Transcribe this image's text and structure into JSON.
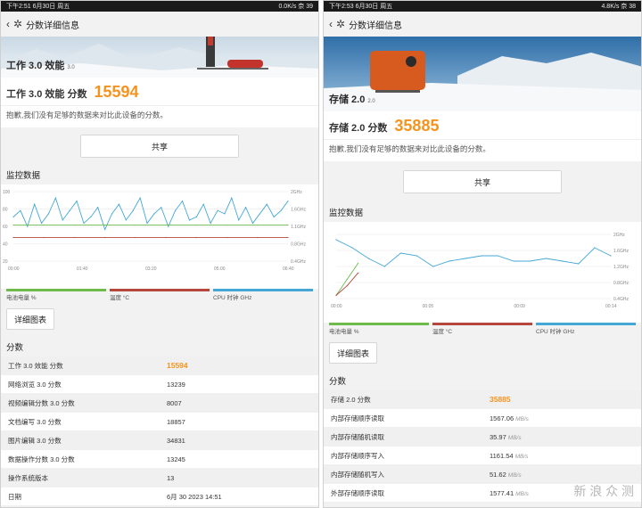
{
  "left": {
    "status": {
      "time": "下午2:51",
      "date": "6月30日 周五",
      "right": "0.0K/s 奈 39"
    },
    "title": "分数详细信息",
    "hero": {
      "name": "工作 3.0 效能",
      "version": "3.0"
    },
    "score_label": "工作 3.0 效能 分数",
    "score": "15594",
    "note": "抱歉,我们没有足够的数据来对比此设备的分数。",
    "share": "共享",
    "monitor_title": "监控数据",
    "legend": [
      {
        "label": "电池电量 %",
        "color": "#6dbb4b"
      },
      {
        "label": "温度 °C",
        "color": "#b5473e"
      },
      {
        "label": "CPU 时钟 GHz",
        "color": "#45a7d6"
      }
    ],
    "y_left_ticks": [
      "100",
      "80",
      "60",
      "40",
      "20"
    ],
    "y_right_ticks": [
      "2GHz",
      "1.6GHz",
      "1.1GHz",
      "0.8GHz",
      "0.4GHz"
    ],
    "x_ticks": [
      "00:00",
      "01:40",
      "03:20",
      "05:00",
      "06:40"
    ],
    "detail_btn": "详细图表",
    "scores_title": "分数",
    "rows": [
      {
        "k": "工作 3.0 效能 分数",
        "v": "15594",
        "hl": true
      },
      {
        "k": "网络浏览 3.0 分数",
        "v": "13239"
      },
      {
        "k": "视频编辑分数 3.0 分数",
        "v": "8007"
      },
      {
        "k": "文档编写 3.0 分数",
        "v": "18857"
      },
      {
        "k": "图片编辑 3.0 分数",
        "v": "34831"
      },
      {
        "k": "数据操作分数 3.0 分数",
        "v": "13245"
      },
      {
        "k": "操作系统版本",
        "v": "13"
      },
      {
        "k": "日期",
        "v": "6月 30 2023 14:51"
      }
    ]
  },
  "right": {
    "status": {
      "time": "下午2:53",
      "date": "6月30日 周五",
      "right": "4.8K/s 奈 38"
    },
    "title": "分数详细信息",
    "hero": {
      "name": "存储 2.0",
      "version": "2.0"
    },
    "score_label": "存储 2.0 分数",
    "score": "35885",
    "note": "抱歉,我们没有足够的数据来对比此设备的分数。",
    "share": "共享",
    "monitor_title": "监控数据",
    "legend": [
      {
        "label": "电池电量 %",
        "color": "#6dbb4b"
      },
      {
        "label": "温度 °C",
        "color": "#b5473e"
      },
      {
        "label": "CPU 时钟 GHz",
        "color": "#45a7d6"
      }
    ],
    "y_right_ticks": [
      "2GHz",
      "1.6GHz",
      "1.2GHz",
      "0.8GHz",
      "0.4GHz"
    ],
    "x_ticks": [
      "00:00",
      "00:05",
      "00:09",
      "00:14"
    ],
    "detail_btn": "详细图表",
    "scores_title": "分数",
    "rows": [
      {
        "k": "存储 2.0 分数",
        "v": "35885",
        "hl": true
      },
      {
        "k": "内部存储顺序读取",
        "v": "1567.06",
        "unit": "MB/s"
      },
      {
        "k": "内部存储随机读取",
        "v": "35.97",
        "unit": "MB/s"
      },
      {
        "k": "内部存储顺序写入",
        "v": "1161.54",
        "unit": "MB/s"
      },
      {
        "k": "内部存储随机写入",
        "v": "51.62",
        "unit": "MB/s"
      },
      {
        "k": "外部存储顺序读取",
        "v": "1577.41",
        "unit": "MB/s"
      }
    ]
  },
  "watermark": "新 浪 众 测",
  "chart_data": [
    {
      "type": "line",
      "title": "监控数据",
      "series": [
        {
          "name": "CPU 时钟 GHz",
          "values": [
            1.4,
            1.6,
            1.1,
            1.8,
            1.2,
            1.5,
            2.0,
            1.3,
            1.6,
            1.9,
            1.2,
            1.4,
            1.7,
            1.0,
            1.5,
            1.8,
            1.3,
            1.6,
            2.0,
            1.2,
            1.5,
            1.7,
            1.1,
            1.6,
            1.9,
            1.3,
            1.4,
            1.8,
            1.2,
            1.6,
            1.5,
            2.0,
            1.3,
            1.7,
            1.2,
            1.5,
            1.8,
            1.4,
            1.6,
            1.9
          ]
        },
        {
          "name": "电池电量 %",
          "values": [
            52,
            52,
            52,
            52,
            52,
            52,
            52,
            52,
            52,
            52
          ]
        },
        {
          "name": "温度 °C",
          "values": [
            34,
            34,
            34,
            34,
            34,
            34,
            34,
            34,
            34,
            34
          ]
        }
      ]
    },
    {
      "type": "line",
      "title": "监控数据",
      "series": [
        {
          "name": "CPU 时钟 GHz",
          "values": [
            2.2,
            1.9,
            1.5,
            1.2,
            1.7,
            1.6,
            1.2,
            1.4,
            1.5,
            1.6,
            1.6,
            1.4,
            1.4,
            1.5,
            1.4,
            1.3,
            1.9,
            1.6
          ]
        },
        {
          "name": "电池电量 %",
          "values": [
            5,
            30,
            55
          ]
        },
        {
          "name": "温度 °C",
          "values": [
            5,
            20,
            40
          ]
        }
      ]
    }
  ]
}
